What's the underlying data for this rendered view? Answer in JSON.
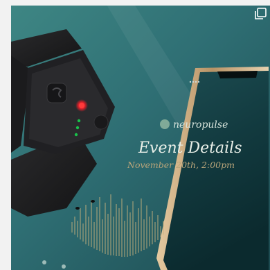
{
  "image": {
    "subject": "black wrist-worn wearable sensor beside a smartphone",
    "corner_icon": "multiple-photos-icon"
  },
  "phone_screen": {
    "brand": "neuropulse",
    "title": "Event Details",
    "date": "November 20th, 2:00pm"
  },
  "colors": {
    "background_teal": "#2f6f74",
    "screen_dark": "#0f2f33",
    "band_black": "#1e1e20",
    "led_red": "#e0202a",
    "led_green": "#19c24a",
    "phone_gold": "#c9a77a"
  }
}
